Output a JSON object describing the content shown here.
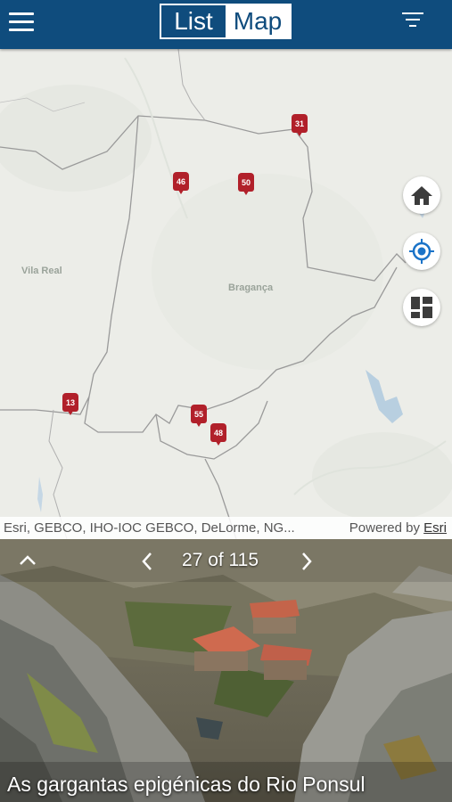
{
  "topbar": {
    "view_list": "List",
    "view_map": "Map",
    "active_view": "Map"
  },
  "map": {
    "places": [
      "Vila Real",
      "Bragança"
    ],
    "markers": [
      "31",
      "46",
      "50",
      "13",
      "55",
      "48"
    ],
    "controls": [
      "home-icon",
      "locate-icon",
      "basemap-gallery-icon"
    ],
    "attribution": "Esri, GEBCO, IHO-IOC GEBCO, DeLorme, NG...",
    "powered_by": "Powered by",
    "powered_by_link": "Esri"
  },
  "carousel": {
    "position": "27 of 115",
    "caption": "As gargantas epigénicas do Rio Ponsul"
  },
  "colors": {
    "header": "#0f4c7d",
    "marker": "#b1202a",
    "locate": "#1a73c8"
  }
}
